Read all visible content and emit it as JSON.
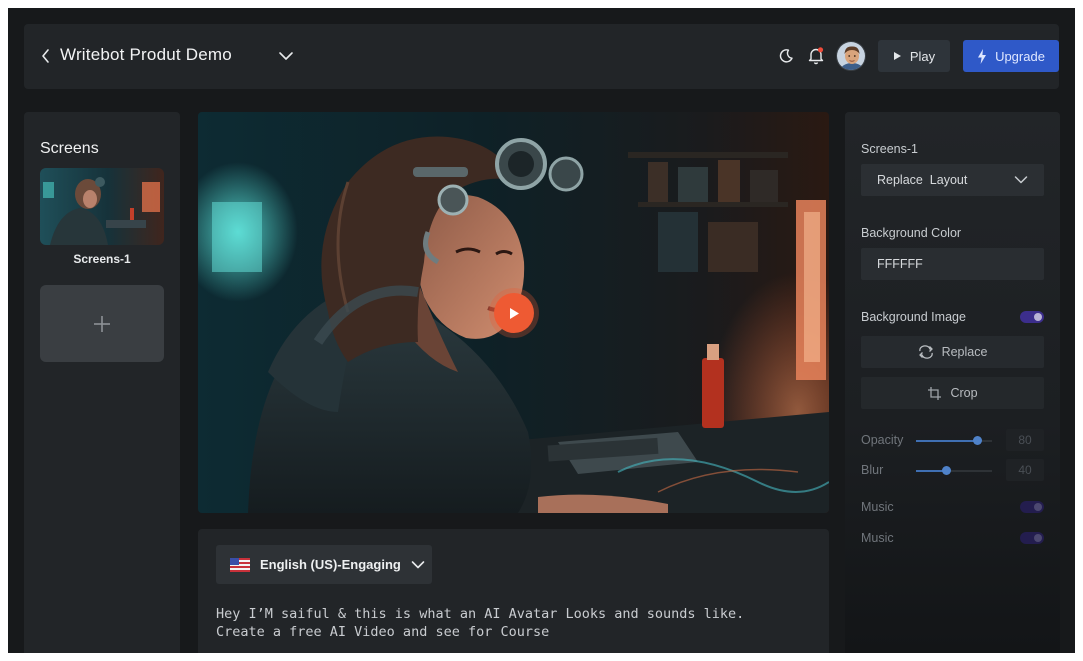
{
  "header": {
    "project_title": "Writebot Produt Demo",
    "play_label": "Play",
    "upgrade_label": "Upgrade"
  },
  "icons": [
    "back-chevron-icon",
    "chevron-down-icon",
    "moon-icon",
    "bell-icon",
    "play-icon",
    "lightning-icon",
    "plus-icon",
    "flag-us-icon",
    "replace-icon",
    "crop-icon"
  ],
  "colors": {
    "background": "#17191b",
    "panel": "#222528",
    "accent_blue": "#2f59c8",
    "play_orange": "#ee5a33",
    "toggle_purple": "#3c2e8c",
    "slider_blue": "#4f82c9"
  },
  "screens": {
    "heading": "Screens",
    "items": [
      {
        "label": "Screens-1"
      }
    ]
  },
  "script": {
    "voice_label": "English (US)-Engaging",
    "text_line_1": "Hey I’M saiful & this is what an AI Avatar Looks and sounds like.",
    "text_line_2": "Create a free AI Video and see for Course"
  },
  "properties": {
    "screen_title": "Screens-1",
    "layout_value": "Replace  Layout",
    "background_color_label": "Background Color",
    "background_color_value": "FFFFFF",
    "background_image_label": "Background Image",
    "background_image_enabled": true,
    "replace_label": "Replace",
    "crop_label": "Crop",
    "opacity_label": "Opacity",
    "opacity_value": "80",
    "opacity_level": 0.8,
    "blur_label": "Blur",
    "blur_value": "40",
    "blur_level": 0.4,
    "music_label_1": "Music",
    "music_label_2": "Music",
    "music_1_enabled": true,
    "music_2_enabled": true
  }
}
